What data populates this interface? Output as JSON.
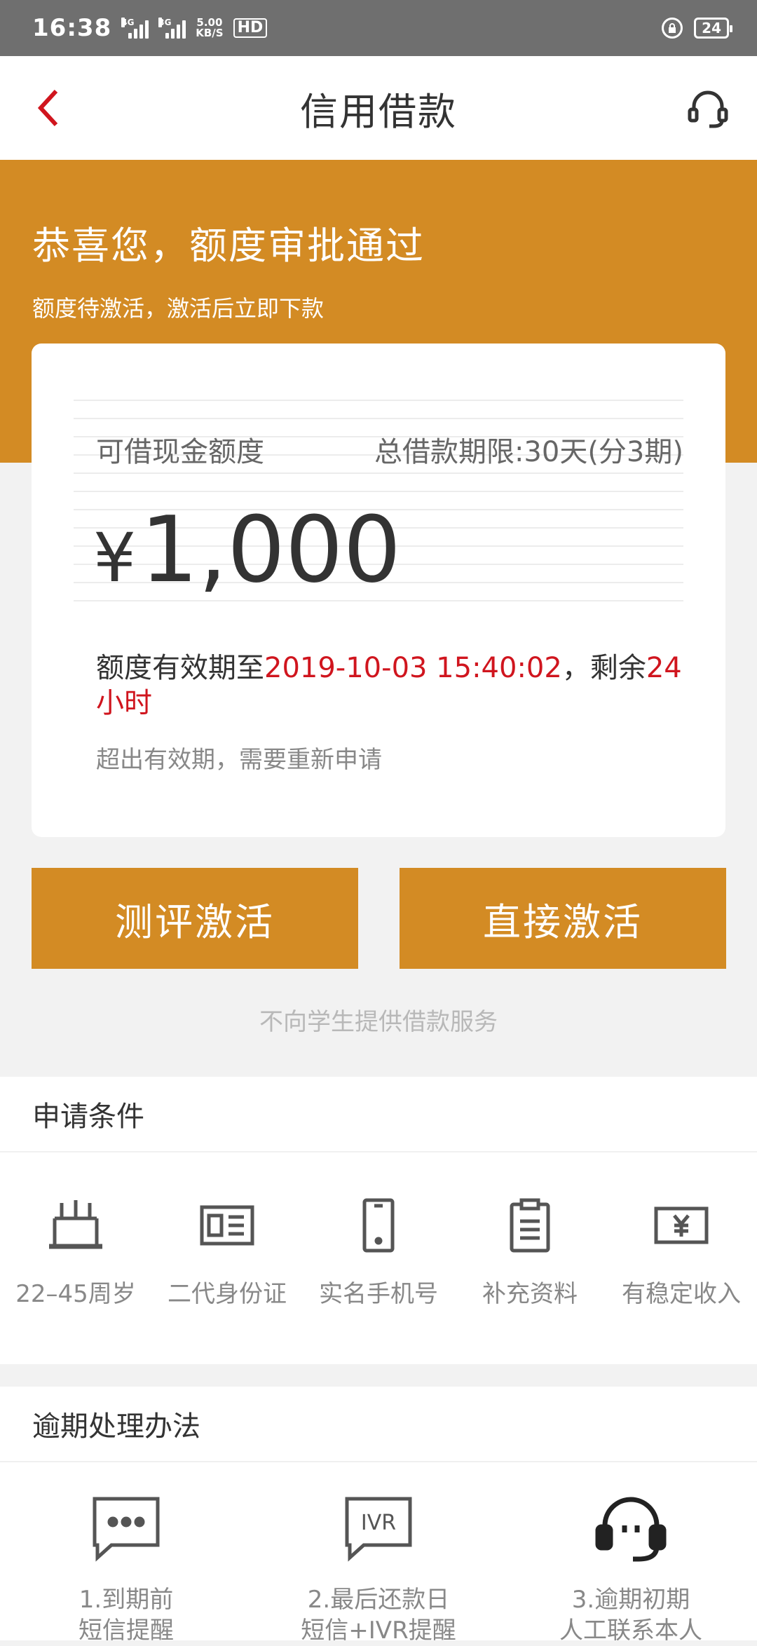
{
  "status_bar": {
    "time": "16:38",
    "signal_1_tag": "4G",
    "signal_2_tag": "3G",
    "net_speed_value": "5.00",
    "net_speed_unit": "KB/S",
    "hd": "HD",
    "battery": "24"
  },
  "header": {
    "title": "信用借款",
    "back_icon": "chevron-left-icon",
    "service_icon": "headset-icon"
  },
  "banner": {
    "title": "恭喜您，额度审批通过",
    "subtitle": "额度待激活，激活后立即下款"
  },
  "card": {
    "label": "可借现金额度",
    "term": "总借款期限:30天(分3期)",
    "currency": "¥",
    "amount": "1,000",
    "validity_prefix": "额度有效期至",
    "validity_date": "2019-10-03 15:40:02",
    "validity_middle": "，剩余",
    "validity_remaining": "24小时",
    "renew_note": "超出有效期，需要重新申请"
  },
  "actions": {
    "evaluate_label": "测评激活",
    "direct_label": "直接激活"
  },
  "notice": "不向学生提供借款服务",
  "conditions": {
    "title": "申请条件",
    "items": [
      {
        "label": "22–45周岁",
        "icon": "cake-icon"
      },
      {
        "label": "二代身份证",
        "icon": "id-card-icon"
      },
      {
        "label": "实名手机号",
        "icon": "phone-icon"
      },
      {
        "label": "补充资料",
        "icon": "clipboard-icon"
      },
      {
        "label": "有稳定收入",
        "icon": "income-icon"
      }
    ]
  },
  "overdue": {
    "title": "逾期处理办法",
    "items": [
      {
        "line1": "1.到期前",
        "line2": "短信提醒",
        "icon": "sms-bubble-icon"
      },
      {
        "line1": "2.最后还款日",
        "line2": "短信+IVR提醒",
        "icon": "ivr-bubble-icon"
      },
      {
        "line1": "3.逾期初期",
        "line2": "人工联系本人",
        "icon": "headset-icon"
      }
    ]
  },
  "colors": {
    "accent": "#d38b24",
    "highlight_red": "#d0151e"
  }
}
